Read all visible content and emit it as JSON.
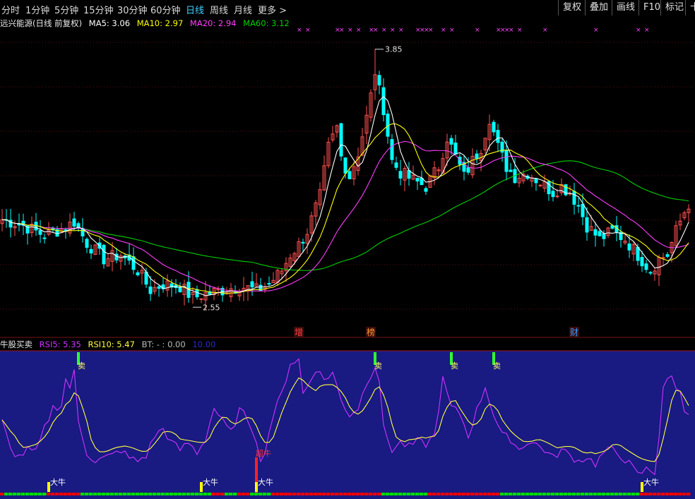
{
  "toolbar": {
    "timeframes": [
      "分时",
      "1分钟",
      "5分钟",
      "15分钟",
      "30分钟",
      "60分钟",
      "日线",
      "周线",
      "月线"
    ],
    "active": "日线",
    "more": "更多 >",
    "buttons": [
      "复权",
      "叠加",
      "画线",
      "F10",
      "标记"
    ],
    "last": "十"
  },
  "main_header": {
    "title": "远兴能源(日线 前复权)",
    "ma5": "MA5: 3.06",
    "ma10": "MA10: 2.97",
    "ma20": "MA20: 2.94",
    "ma60": "MA60: 3.12"
  },
  "sub_header": {
    "title": "牛股买卖",
    "rsi5": "RSI5: 5.35",
    "rsi10": "RSI10: 5.47",
    "bt": "BT: - : 0.00",
    "v4": "10.00"
  },
  "colors": {
    "up": "#ff4f4f",
    "down": "#00ffff",
    "ma5": "#ffffff",
    "ma10": "#ffff00",
    "ma20": "#ff3cff",
    "ma60": "#00d000",
    "rsi5": "#cc33ff",
    "rsi10": "#ffff40",
    "panel_bg": "#191a82",
    "bar_green": "#00dd00",
    "bar_red": "#ee0000"
  },
  "chart_data": [
    {
      "type": "candlestick",
      "title": "远兴能源(日线 前复权)",
      "ylim": [
        2.45,
        3.95
      ],
      "annotations": [
        {
          "label": "3.85",
          "day": 88,
          "price": 3.85
        },
        {
          "label": "2.55",
          "day": 45,
          "price": 2.55
        }
      ],
      "event_markers": [
        {
          "label": "增",
          "day": 70,
          "color": "#ff4040"
        },
        {
          "label": "榜",
          "day": 87,
          "color": "#ff9a30"
        },
        {
          "label": "财",
          "day": 135,
          "color": "#2fa0ff"
        }
      ],
      "anchors": [
        [
          0,
          2.98
        ],
        [
          5,
          2.95
        ],
        [
          10,
          2.9
        ],
        [
          15,
          2.94
        ],
        [
          17,
          2.97
        ],
        [
          20,
          2.86
        ],
        [
          24,
          2.78
        ],
        [
          28,
          2.8
        ],
        [
          32,
          2.72
        ],
        [
          35,
          2.62
        ],
        [
          38,
          2.65
        ],
        [
          42,
          2.64
        ],
        [
          45,
          2.58
        ],
        [
          48,
          2.6
        ],
        [
          52,
          2.62
        ],
        [
          56,
          2.64
        ],
        [
          60,
          2.62
        ],
        [
          63,
          2.65
        ],
        [
          66,
          2.72
        ],
        [
          68,
          2.8
        ],
        [
          70,
          2.85
        ],
        [
          72,
          2.92
        ],
        [
          75,
          3.1
        ],
        [
          77,
          3.35
        ],
        [
          79,
          3.45
        ],
        [
          80,
          3.3
        ],
        [
          82,
          3.2
        ],
        [
          84,
          3.32
        ],
        [
          86,
          3.5
        ],
        [
          88,
          3.72
        ],
        [
          90,
          3.55
        ],
        [
          92,
          3.28
        ],
        [
          94,
          3.22
        ],
        [
          97,
          3.18
        ],
        [
          100,
          3.15
        ],
        [
          103,
          3.25
        ],
        [
          105,
          3.4
        ],
        [
          107,
          3.3
        ],
        [
          109,
          3.2
        ],
        [
          111,
          3.28
        ],
        [
          113,
          3.35
        ],
        [
          115,
          3.5
        ],
        [
          117,
          3.35
        ],
        [
          119,
          3.25
        ],
        [
          121,
          3.2
        ],
        [
          124,
          3.22
        ],
        [
          127,
          3.17
        ],
        [
          130,
          3.12
        ],
        [
          132,
          3.15
        ],
        [
          134,
          3.12
        ],
        [
          136,
          3.05
        ],
        [
          138,
          2.95
        ],
        [
          141,
          2.88
        ],
        [
          144,
          2.92
        ],
        [
          147,
          2.88
        ],
        [
          150,
          2.8
        ],
        [
          153,
          2.72
        ],
        [
          155,
          2.78
        ],
        [
          157,
          2.8
        ],
        [
          159,
          2.92
        ],
        [
          161,
          3.02
        ],
        [
          162,
          3.06
        ]
      ]
    },
    {
      "type": "line",
      "title": "牛股买卖",
      "series": [
        {
          "name": "RSI5"
        },
        {
          "name": "RSI10"
        }
      ],
      "ylim": [
        0,
        100
      ],
      "rsi_anchors": [
        [
          0,
          50
        ],
        [
          2,
          30
        ],
        [
          4,
          25
        ],
        [
          6,
          30
        ],
        [
          8,
          28
        ],
        [
          10,
          45
        ],
        [
          12,
          60
        ],
        [
          14,
          62
        ],
        [
          15,
          80
        ],
        [
          16,
          75
        ],
        [
          17,
          85
        ],
        [
          18,
          50
        ],
        [
          20,
          28
        ],
        [
          22,
          22
        ],
        [
          24,
          24
        ],
        [
          26,
          26
        ],
        [
          28,
          30
        ],
        [
          30,
          24
        ],
        [
          32,
          22
        ],
        [
          34,
          26
        ],
        [
          36,
          40
        ],
        [
          38,
          45
        ],
        [
          40,
          35
        ],
        [
          42,
          30
        ],
        [
          44,
          35
        ],
        [
          46,
          28
        ],
        [
          48,
          38
        ],
        [
          50,
          60
        ],
        [
          52,
          50
        ],
        [
          54,
          42
        ],
        [
          56,
          58
        ],
        [
          58,
          52
        ],
        [
          60,
          38
        ],
        [
          61,
          20
        ],
        [
          62,
          30
        ],
        [
          64,
          55
        ],
        [
          66,
          70
        ],
        [
          68,
          92
        ],
        [
          70,
          94
        ],
        [
          71,
          70
        ],
        [
          72,
          75
        ],
        [
          74,
          88
        ],
        [
          76,
          80
        ],
        [
          78,
          85
        ],
        [
          80,
          65
        ],
        [
          82,
          55
        ],
        [
          84,
          60
        ],
        [
          86,
          78
        ],
        [
          88,
          90
        ],
        [
          89,
          80
        ],
        [
          90,
          45
        ],
        [
          92,
          30
        ],
        [
          94,
          35
        ],
        [
          96,
          32
        ],
        [
          98,
          36
        ],
        [
          100,
          34
        ],
        [
          102,
          40
        ],
        [
          104,
          80
        ],
        [
          106,
          60
        ],
        [
          108,
          56
        ],
        [
          110,
          40
        ],
        [
          112,
          58
        ],
        [
          114,
          75
        ],
        [
          116,
          55
        ],
        [
          118,
          40
        ],
        [
          120,
          38
        ],
        [
          122,
          30
        ],
        [
          124,
          36
        ],
        [
          126,
          34
        ],
        [
          128,
          30
        ],
        [
          130,
          24
        ],
        [
          132,
          30
        ],
        [
          134,
          26
        ],
        [
          136,
          22
        ],
        [
          138,
          25
        ],
        [
          140,
          20
        ],
        [
          142,
          28
        ],
        [
          144,
          30
        ],
        [
          146,
          26
        ],
        [
          148,
          20
        ],
        [
          150,
          12
        ],
        [
          152,
          16
        ],
        [
          154,
          14
        ],
        [
          155,
          40
        ],
        [
          156,
          75
        ],
        [
          158,
          82
        ],
        [
          160,
          70
        ],
        [
          161,
          58
        ]
      ],
      "signals_top": [
        {
          "label": "卖",
          "day": 18
        },
        {
          "label": "卖",
          "day": 88
        },
        {
          "label": "卖",
          "day": 106
        },
        {
          "label": "卖",
          "day": 116
        }
      ],
      "signals_bottom": [
        {
          "label": "大牛",
          "day": 11,
          "color": "#ffff00"
        },
        {
          "label": "大牛",
          "day": 47,
          "color": "#ffff00"
        },
        {
          "label": "大牛",
          "day": 60,
          "color": "#ffff00"
        },
        {
          "label": "大牛",
          "day": 151,
          "color": "#ffff00"
        }
      ],
      "red_signal": {
        "label": "超牛",
        "day": 60
      }
    }
  ]
}
